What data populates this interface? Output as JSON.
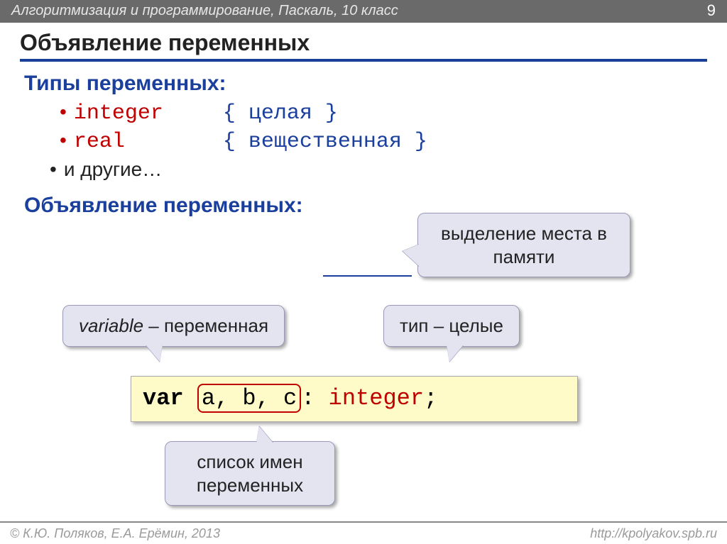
{
  "header": {
    "breadcrumb": "Алгоритмизация и программирование, Паскаль, 10 класс",
    "page_number": "9"
  },
  "title": "Объявление переменных",
  "types_heading": "Типы переменных:",
  "types": [
    {
      "keyword": "integer",
      "comment": "{ целая }"
    },
    {
      "keyword": "real",
      "comment": "{ вещественная }"
    }
  ],
  "types_more": "и другие…",
  "decl_heading": "Объявление переменных:",
  "callouts": {
    "memory": "выделение места в памяти",
    "variable_prefix": "variable",
    "variable_suffix": " – переменная",
    "type": "тип – целые",
    "names": "список имен переменных"
  },
  "code": {
    "kw_var": "var",
    "vars": "a, b, c",
    "colon_type": ": ",
    "type_kw": "integer",
    "semi": ";"
  },
  "footer": {
    "left": "К.Ю. Поляков, Е.А. Ерёмин, 2013",
    "right": "http://kpolyakov.spb.ru"
  }
}
